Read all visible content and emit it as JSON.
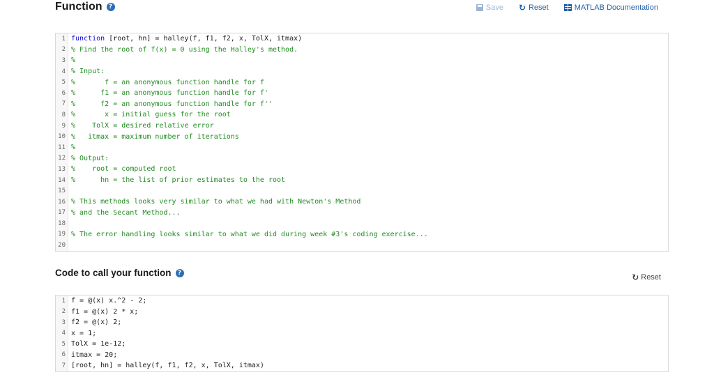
{
  "function_section": {
    "title": "Function",
    "help_glyph": "?"
  },
  "toolbar": {
    "save_label": "Save",
    "reset_label": "Reset",
    "docs_label": "MATLAB Documentation",
    "save_icon": "save-icon",
    "reset_icon": "reset-icon",
    "docs_icon": "grid-icon"
  },
  "function_code": [
    {
      "num": "1",
      "kw": "function",
      "text": " [root, hn] = halley(f, f1, f2, x, TolX, itmax)",
      "comment": false
    },
    {
      "num": "2",
      "kw": "",
      "text": "% Find the root of f(x) = 0 using the Halley's method.",
      "comment": true
    },
    {
      "num": "3",
      "kw": "",
      "text": "%",
      "comment": true
    },
    {
      "num": "4",
      "kw": "",
      "text": "% Input:",
      "comment": true
    },
    {
      "num": "5",
      "kw": "",
      "text": "%       f = an anonymous function handle for f",
      "comment": true
    },
    {
      "num": "6",
      "kw": "",
      "text": "%      f1 = an anonymous function handle for f'",
      "comment": true
    },
    {
      "num": "7",
      "kw": "",
      "text": "%      f2 = an anonymous function handle for f''",
      "comment": true
    },
    {
      "num": "8",
      "kw": "",
      "text": "%       x = initial guess for the root",
      "comment": true
    },
    {
      "num": "9",
      "kw": "",
      "text": "%    TolX = desired relative error",
      "comment": true
    },
    {
      "num": "10",
      "kw": "",
      "text": "%   itmax = maximum number of iterations",
      "comment": true
    },
    {
      "num": "11",
      "kw": "",
      "text": "%",
      "comment": true
    },
    {
      "num": "12",
      "kw": "",
      "text": "% Output:",
      "comment": true
    },
    {
      "num": "13",
      "kw": "",
      "text": "%    root = computed root",
      "comment": true
    },
    {
      "num": "14",
      "kw": "",
      "text": "%      hn = the list of prior estimates to the root",
      "comment": true
    },
    {
      "num": "15",
      "kw": "",
      "text": "",
      "comment": false
    },
    {
      "num": "16",
      "kw": "",
      "text": "% This methods looks very similar to what we had with Newton's Method",
      "comment": true
    },
    {
      "num": "17",
      "kw": "",
      "text": "% and the Secant Method...",
      "comment": true
    },
    {
      "num": "18",
      "kw": "",
      "text": "",
      "comment": false
    },
    {
      "num": "19",
      "kw": "",
      "text": "% The error handling looks similar to what we did during week #3's coding exercise...",
      "comment": true
    },
    {
      "num": "20",
      "kw": "",
      "text": "",
      "comment": false
    }
  ],
  "call_section": {
    "title": "Code to call your function",
    "help_glyph": "?",
    "reset_label": "Reset"
  },
  "call_code": [
    {
      "num": "1",
      "text": "f = @(x) x.^2 - 2;"
    },
    {
      "num": "2",
      "text": "f1 = @(x) 2 * x;"
    },
    {
      "num": "3",
      "text": "f2 = @(x) 2;"
    },
    {
      "num": "4",
      "text": "x = 1;"
    },
    {
      "num": "5",
      "text": "TolX = 1e-12;"
    },
    {
      "num": "6",
      "text": "itmax = 20;"
    },
    {
      "num": "7",
      "text": "[root, hn] = halley(f, f1, f2, x, TolX, itmax)"
    }
  ]
}
